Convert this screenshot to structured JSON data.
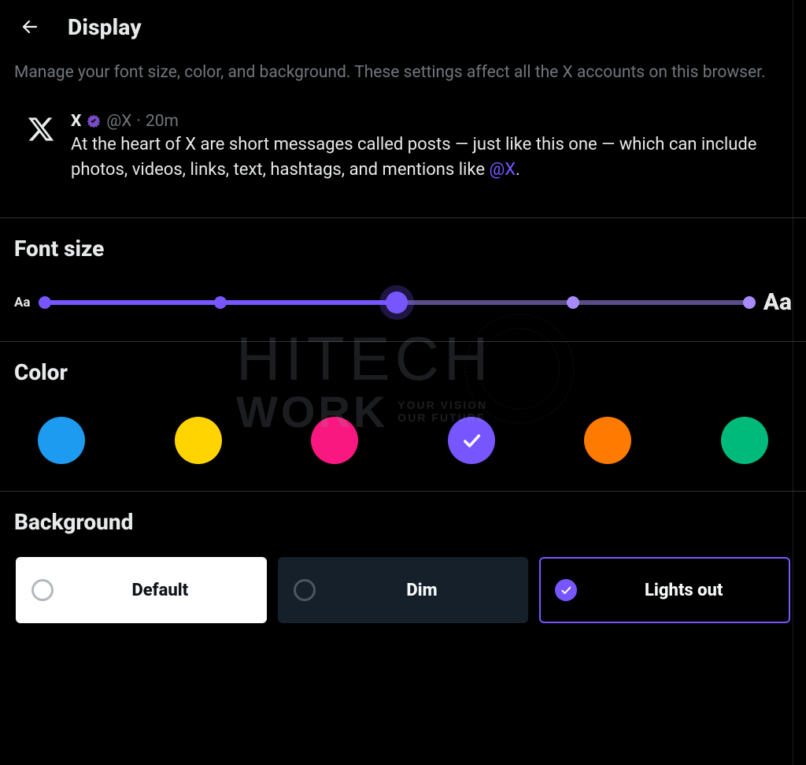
{
  "header": {
    "title": "Display"
  },
  "description": "Manage your font size, color, and background. These settings affect all the X accounts on this browser.",
  "sample_post": {
    "name": "X",
    "handle": "@X",
    "time": "20m",
    "body_pre": "At the heart of X are short messages called posts — just like this one — which can include photos, videos, links, text, hashtags, and mentions like ",
    "mention": "@X",
    "body_post": "."
  },
  "font_size": {
    "title": "Font size",
    "label_small": "Aa",
    "label_large": "Aa",
    "steps": 5,
    "selected_index": 2
  },
  "color": {
    "title": "Color",
    "options": [
      {
        "hex": "#1d9bf0",
        "selected": false
      },
      {
        "hex": "#ffd400",
        "selected": false
      },
      {
        "hex": "#f91880",
        "selected": false
      },
      {
        "hex": "#7856ff",
        "selected": true
      },
      {
        "hex": "#ff7a00",
        "selected": false
      },
      {
        "hex": "#00ba7c",
        "selected": false
      }
    ]
  },
  "background": {
    "title": "Background",
    "options": [
      {
        "key": "default",
        "label": "Default",
        "selected": false
      },
      {
        "key": "dim",
        "label": "Dim",
        "selected": false
      },
      {
        "key": "lights_out",
        "label": "Lights out",
        "selected": true
      }
    ]
  },
  "watermark": {
    "line1": "HITECH",
    "line2": "WORK",
    "tag1": "YOUR VISION",
    "tag2": "OUR FUTURE"
  }
}
